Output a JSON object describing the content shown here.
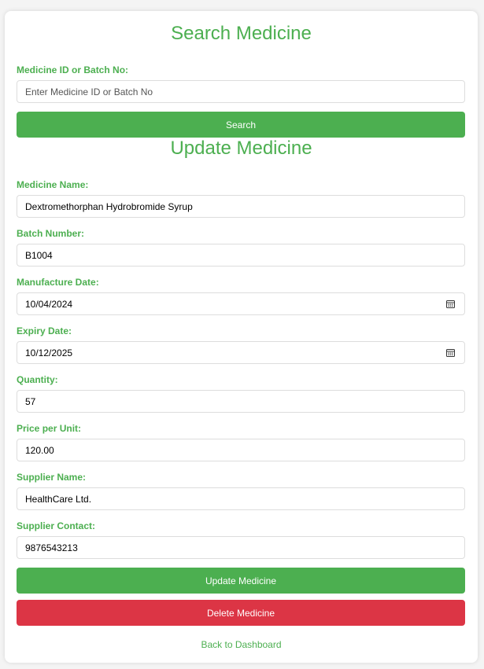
{
  "search": {
    "title": "Search Medicine",
    "field_label": "Medicine ID or Batch No:",
    "placeholder": "Enter Medicine ID or Batch No",
    "value": "",
    "button_label": "Search"
  },
  "update": {
    "title": "Update Medicine",
    "fields": {
      "medicine_name": {
        "label": "Medicine Name:",
        "value": "Dextromethorphan Hydrobromide Syrup"
      },
      "batch_number": {
        "label": "Batch Number:",
        "value": "B1004"
      },
      "manufacture_date": {
        "label": "Manufacture Date:",
        "value": "10/04/2024"
      },
      "expiry_date": {
        "label": "Expiry Date:",
        "value": "10/12/2025"
      },
      "quantity": {
        "label": "Quantity:",
        "value": "57"
      },
      "price_per_unit": {
        "label": "Price per Unit:",
        "value": "120.00"
      },
      "supplier_name": {
        "label": "Supplier Name:",
        "value": "HealthCare Ltd."
      },
      "supplier_contact": {
        "label": "Supplier Contact:",
        "value": "9876543213"
      }
    },
    "update_button_label": "Update Medicine",
    "delete_button_label": "Delete Medicine"
  },
  "back_link_label": "Back to Dashboard",
  "colors": {
    "accent_green": "#4caf50",
    "danger_red": "#dc3545",
    "background": "#f4f4f4",
    "card": "#ffffff"
  },
  "icons": {
    "date_picker": "calendar-icon"
  }
}
